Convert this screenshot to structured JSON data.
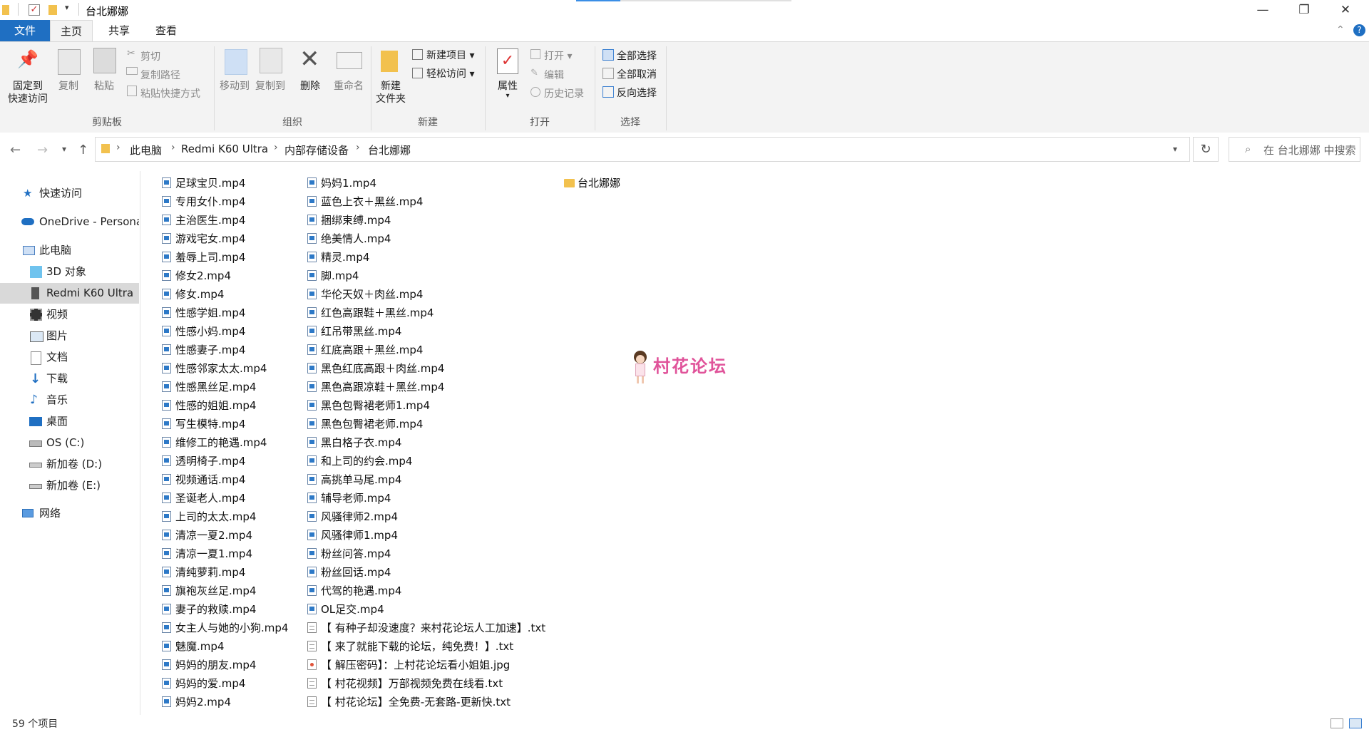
{
  "window": {
    "title": "台北娜娜",
    "controls": {
      "minimize": "—",
      "restore": "❐",
      "close": "✕"
    }
  },
  "ribbon_tabs": [
    "文件",
    "主页",
    "共享",
    "查看"
  ],
  "ribbon": {
    "clipboard": {
      "group": "剪贴板",
      "pin_line1": "固定到",
      "pin_line2": "快速访问",
      "copy": "复制",
      "paste": "粘贴",
      "cut": "剪切",
      "copy_path": "复制路径",
      "paste_shortcut": "粘贴快捷方式"
    },
    "organize": {
      "group": "组织",
      "move_to": "移动到",
      "copy_to": "复制到",
      "delete": "删除",
      "rename": "重命名"
    },
    "new": {
      "group": "新建",
      "new_folder_line1": "新建",
      "new_folder_line2": "文件夹",
      "new_item": "新建项目",
      "easy_access": "轻松访问"
    },
    "open": {
      "group": "打开",
      "properties": "属性",
      "open": "打开",
      "edit": "编辑",
      "history": "历史记录"
    },
    "select": {
      "group": "选择",
      "select_all": "全部选择",
      "select_none": "全部取消",
      "invert": "反向选择"
    }
  },
  "address": {
    "breadcrumb": [
      "此电脑",
      "Redmi K60 Ultra",
      "内部存储设备",
      "台北娜娜"
    ],
    "search_placeholder": "在 台北娜娜 中搜索"
  },
  "sidebar": [
    {
      "label": "快速访问",
      "icon": "star-icon"
    },
    {
      "label": "OneDrive - Persona",
      "icon": "cloud-icon"
    },
    {
      "label": "此电脑",
      "icon": "computer-icon"
    },
    {
      "label": "3D 对象",
      "icon": "cube-icon"
    },
    {
      "label": "Redmi K60 Ultra",
      "icon": "phone-icon"
    },
    {
      "label": "视频",
      "icon": "video-icon"
    },
    {
      "label": "图片",
      "icon": "picture-icon"
    },
    {
      "label": "文档",
      "icon": "document-icon"
    },
    {
      "label": "下载",
      "icon": "download-icon"
    },
    {
      "label": "音乐",
      "icon": "music-icon"
    },
    {
      "label": "桌面",
      "icon": "desktop-icon"
    },
    {
      "label": "OS (C:)",
      "icon": "drive-icon"
    },
    {
      "label": "新加卷 (D:)",
      "icon": "drive-icon"
    },
    {
      "label": "新加卷 (E:)",
      "icon": "drive-icon"
    },
    {
      "label": "网络",
      "icon": "network-icon"
    }
  ],
  "files_col1": [
    "足球宝贝.mp4",
    "专用女仆.mp4",
    "主治医生.mp4",
    "游戏宅女.mp4",
    "羞辱上司.mp4",
    "修女2.mp4",
    "修女.mp4",
    "性感学姐.mp4",
    "性感小妈.mp4",
    "性感妻子.mp4",
    "性感邻家太太.mp4",
    "性感黑丝足.mp4",
    "性感的姐姐.mp4",
    "写生模特.mp4",
    "维修工的艳遇.mp4",
    "透明椅子.mp4",
    "视频通话.mp4",
    "圣诞老人.mp4",
    "上司的太太.mp4",
    "清凉一夏2.mp4",
    "清凉一夏1.mp4",
    "清纯萝莉.mp4",
    "旗袍灰丝足.mp4",
    "妻子的救赎.mp4",
    "女主人与她的小狗.mp4",
    "魅魔.mp4",
    "妈妈的朋友.mp4",
    "妈妈的爱.mp4",
    "妈妈2.mp4"
  ],
  "files_col2": [
    {
      "name": "妈妈1.mp4",
      "type": "video"
    },
    {
      "name": "蓝色上衣＋黑丝.mp4",
      "type": "video"
    },
    {
      "name": "捆绑束缚.mp4",
      "type": "video"
    },
    {
      "name": "绝美情人.mp4",
      "type": "video"
    },
    {
      "name": "精灵.mp4",
      "type": "video"
    },
    {
      "name": "脚.mp4",
      "type": "video"
    },
    {
      "name": "华伦天奴＋肉丝.mp4",
      "type": "video"
    },
    {
      "name": "红色高跟鞋＋黑丝.mp4",
      "type": "video"
    },
    {
      "name": "红吊带黑丝.mp4",
      "type": "video"
    },
    {
      "name": "红底高跟＋黑丝.mp4",
      "type": "video"
    },
    {
      "name": "黑色红底高跟＋肉丝.mp4",
      "type": "video"
    },
    {
      "name": "黑色高跟凉鞋＋黑丝.mp4",
      "type": "video"
    },
    {
      "name": "黑色包臀裙老师1.mp4",
      "type": "video"
    },
    {
      "name": "黑色包臀裙老师.mp4",
      "type": "video"
    },
    {
      "name": "黑白格子衣.mp4",
      "type": "video"
    },
    {
      "name": "和上司的约会.mp4",
      "type": "video"
    },
    {
      "name": "高挑单马尾.mp4",
      "type": "video"
    },
    {
      "name": "辅导老师.mp4",
      "type": "video"
    },
    {
      "name": "风骚律师2.mp4",
      "type": "video"
    },
    {
      "name": "风骚律师1.mp4",
      "type": "video"
    },
    {
      "name": "粉丝问答.mp4",
      "type": "video"
    },
    {
      "name": "粉丝回话.mp4",
      "type": "video"
    },
    {
      "name": "代驾的艳遇.mp4",
      "type": "video"
    },
    {
      "name": "OL足交.mp4",
      "type": "video"
    },
    {
      "name": "【 有种子却没速度？来村花论坛人工加速】.txt",
      "type": "txt"
    },
    {
      "name": "【 来了就能下载的论坛，纯免费！】.txt",
      "type": "txt"
    },
    {
      "name": "【 解压密码】：上村花论坛看小姐姐.jpg",
      "type": "jpg"
    },
    {
      "name": "【 村花视频】万部视频免费在线看.txt",
      "type": "txt"
    },
    {
      "name": "【 村花论坛】全免费-无套路-更新快.txt",
      "type": "txt"
    }
  ],
  "files_col3": [
    {
      "name": "台北娜娜",
      "type": "folder"
    }
  ],
  "status": {
    "item_count": "59 个项目"
  },
  "watermark": {
    "text": "村花论坛"
  }
}
